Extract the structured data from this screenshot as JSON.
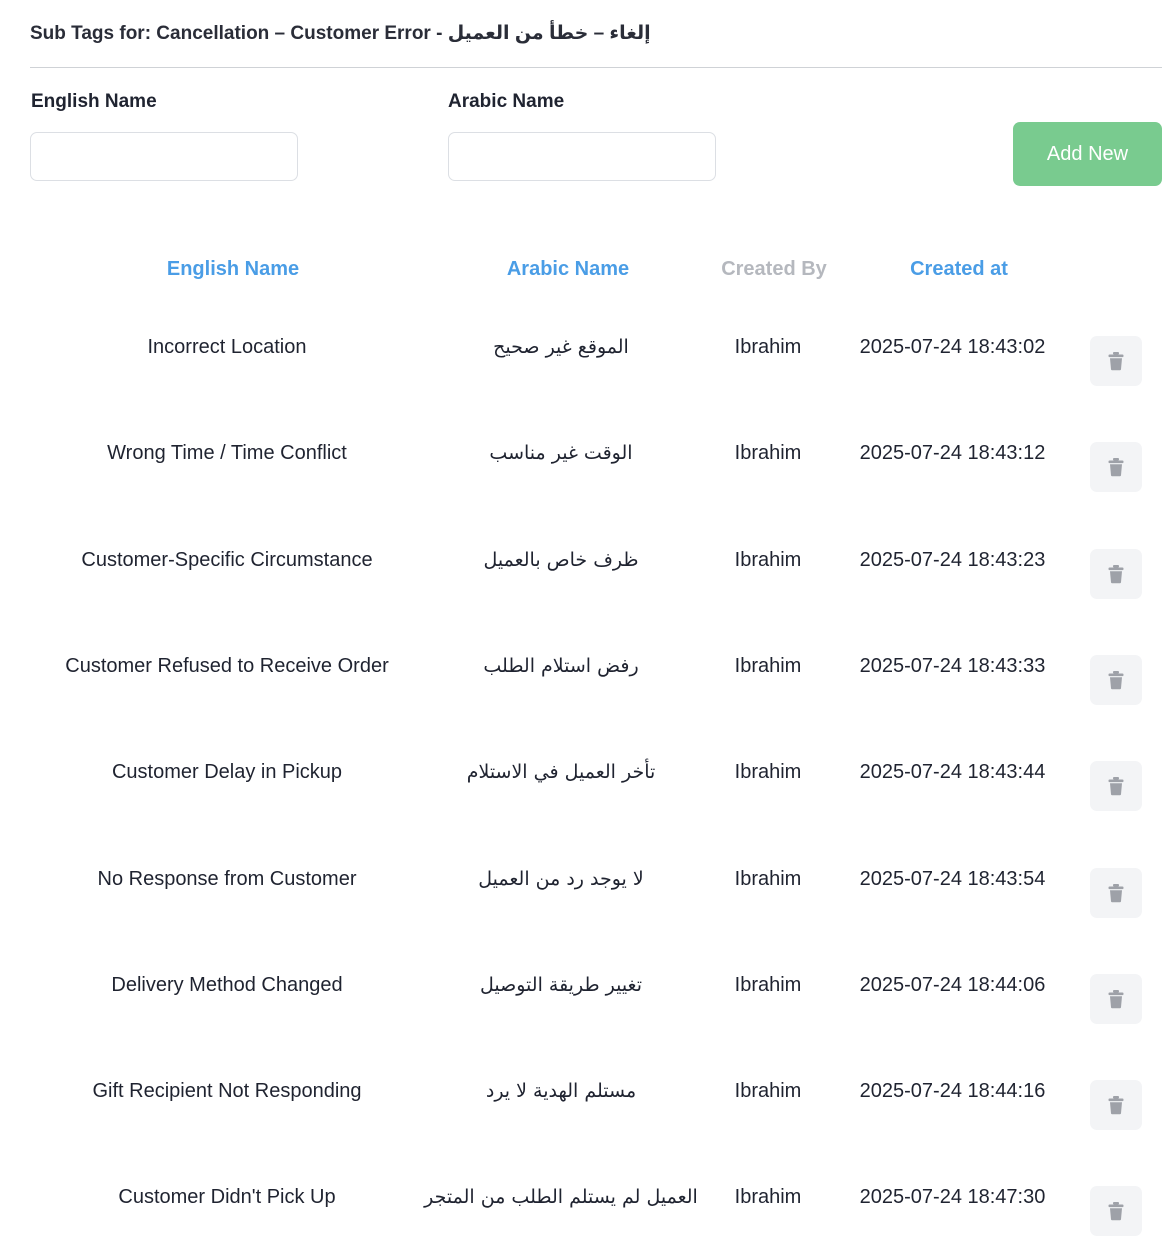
{
  "header": {
    "title": "Sub Tags for: Cancellation – Customer Error - إلغاء – خطأ من العميل"
  },
  "form": {
    "english_label": "English Name",
    "arabic_label": "Arabic Name",
    "english_value": "",
    "arabic_value": "",
    "add_label": "Add New"
  },
  "colors": {
    "accent": "#4a9de6",
    "add_button": "#79cb8f",
    "muted_header": "#b5b8be",
    "delete_icon": "#9ea1a8"
  },
  "table": {
    "columns": [
      "English Name",
      "Arabic Name",
      "Created By",
      "Created at"
    ],
    "action_icon": "trash-icon",
    "rows": [
      {
        "english": "Incorrect Location",
        "arabic": "الموقع غير صحيح",
        "created_by": "Ibrahim",
        "created_at": "2025-07-24 18:43:02"
      },
      {
        "english": "Wrong Time / Time Conflict",
        "arabic": "الوقت غير مناسب",
        "created_by": "Ibrahim",
        "created_at": "2025-07-24 18:43:12"
      },
      {
        "english": "Customer-Specific Circumstance",
        "arabic": "ظرف خاص بالعميل",
        "created_by": "Ibrahim",
        "created_at": "2025-07-24 18:43:23"
      },
      {
        "english": "Customer Refused to Receive Order",
        "arabic": "رفض استلام الطلب",
        "created_by": "Ibrahim",
        "created_at": "2025-07-24 18:43:33"
      },
      {
        "english": "Customer Delay in Pickup",
        "arabic": "تأخر العميل في الاستلام",
        "created_by": "Ibrahim",
        "created_at": "2025-07-24 18:43:44"
      },
      {
        "english": "No Response from Customer",
        "arabic": "لا يوجد رد من العميل",
        "created_by": "Ibrahim",
        "created_at": "2025-07-24 18:43:54"
      },
      {
        "english": "Delivery Method Changed",
        "arabic": "تغيير طريقة التوصيل",
        "created_by": "Ibrahim",
        "created_at": "2025-07-24 18:44:06"
      },
      {
        "english": "Gift Recipient Not Responding",
        "arabic": "مستلم الهدية لا يرد",
        "created_by": "Ibrahim",
        "created_at": "2025-07-24 18:44:16"
      },
      {
        "english": "Customer Didn't Pick Up",
        "arabic": "العميل لم يستلم الطلب من المتجر",
        "created_by": "Ibrahim",
        "created_at": "2025-07-24 18:47:30"
      }
    ]
  }
}
